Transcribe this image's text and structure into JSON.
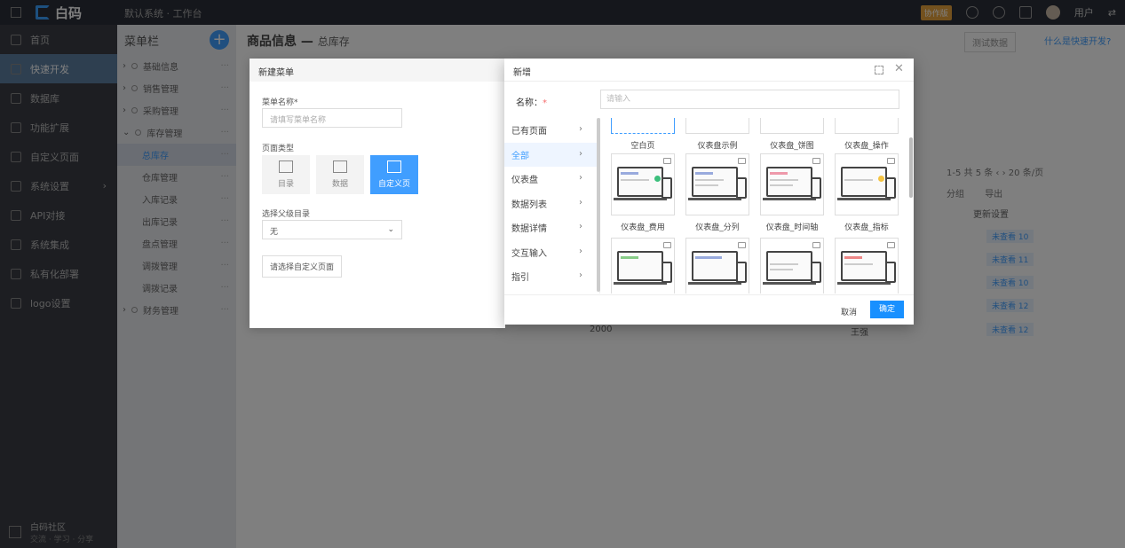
{
  "topbar": {
    "brand": "白码",
    "breadcrumb": "默认系统 · 工作台",
    "badge": "协作版",
    "user": "用户"
  },
  "leftnav": {
    "items": [
      {
        "label": "首页",
        "active": false
      },
      {
        "label": "快速开发",
        "active": true
      },
      {
        "label": "数据库",
        "active": false
      },
      {
        "label": "功能扩展",
        "active": false
      },
      {
        "label": "自定义页面",
        "active": false
      },
      {
        "label": "系统设置",
        "active": false
      },
      {
        "label": "API对接",
        "active": false
      },
      {
        "label": "系统集成",
        "active": false
      },
      {
        "label": "私有化部署",
        "active": false
      },
      {
        "label": "logo设置",
        "active": false
      }
    ],
    "footer_title": "白码社区",
    "footer_sub": "交流 · 学习 · 分享"
  },
  "menucol": {
    "title": "菜单栏",
    "items": [
      {
        "label": "基础信息",
        "level": 0
      },
      {
        "label": "销售管理",
        "level": 0
      },
      {
        "label": "采购管理",
        "level": 0
      },
      {
        "label": "库存管理",
        "level": 0
      },
      {
        "label": "总库存",
        "level": 1,
        "active": true
      },
      {
        "label": "仓库管理",
        "level": 1
      },
      {
        "label": "入库记录",
        "level": 1
      },
      {
        "label": "出库记录",
        "level": 1
      },
      {
        "label": "盘点管理",
        "level": 1
      },
      {
        "label": "调拨管理",
        "level": 1
      },
      {
        "label": "调拨记录",
        "level": 1
      },
      {
        "label": "财务管理",
        "level": 0
      }
    ]
  },
  "main": {
    "title": "商品信息",
    "subtitle": "总库存",
    "test_btn": "测试数据",
    "help_link": "什么是快速开发?",
    "pager": "1-5 共 5 条",
    "page_size": "20 条/页",
    "toolbar_group": "分组",
    "toolbar_export": "导出",
    "col_header": "更新设置",
    "tags": [
      "未查看 10",
      "未查看 11",
      "未查看 10",
      "未查看 12",
      "未查看 12"
    ],
    "row_qty": "2000",
    "row_name": "王强"
  },
  "back_dialog": {
    "title": "新建菜单",
    "name_label": "菜单名称*",
    "name_placeholder": "请填写菜单名称",
    "type_label": "页面类型",
    "types": [
      {
        "label": "目录",
        "active": false
      },
      {
        "label": "数据",
        "active": false
      },
      {
        "label": "自定义页",
        "active": true
      }
    ],
    "parent_label": "选择父级目录",
    "parent_value": "无",
    "choose_btn": "请选择自定义页面"
  },
  "dialog": {
    "title": "新增",
    "name_label": "名称：",
    "name_required_mark": "*",
    "name_placeholder": "请输入",
    "categories": [
      {
        "label": "已有页面",
        "active": false
      },
      {
        "label": "全部",
        "active": true
      },
      {
        "label": "仪表盘",
        "active": false
      },
      {
        "label": "数据列表",
        "active": false
      },
      {
        "label": "数据详情",
        "active": false
      },
      {
        "label": "交互输入",
        "active": false
      },
      {
        "label": "指引",
        "active": false
      }
    ],
    "templates_row1": [
      "空白页",
      "仪表盘示例",
      "仪表盘_饼图",
      "仪表盘_操作"
    ],
    "templates_row2": [
      "仪表盘_费用",
      "仪表盘_分列",
      "仪表盘_时间轴",
      "仪表盘_指标"
    ],
    "cancel": "取消",
    "confirm": "确定"
  }
}
